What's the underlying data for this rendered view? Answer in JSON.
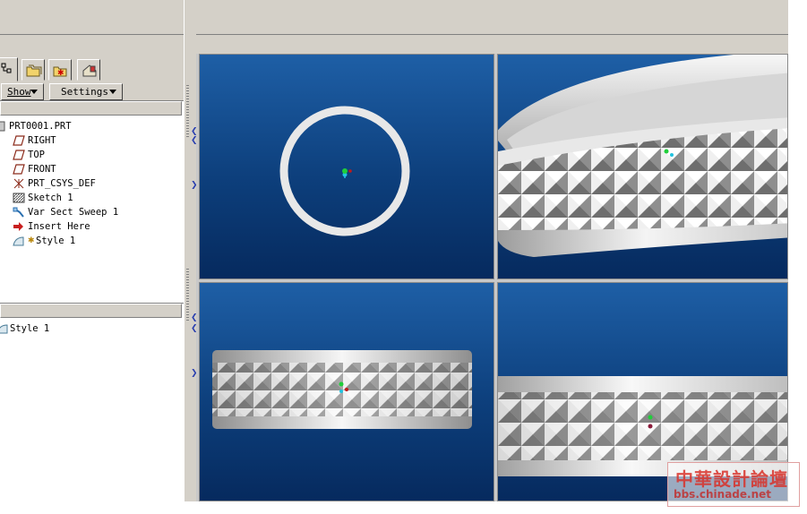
{
  "nav": {
    "tabs": [
      {
        "icon": "model-tree-icon"
      },
      {
        "icon": "folder-browser-icon"
      },
      {
        "icon": "favorites-icon"
      },
      {
        "icon": "connections-icon"
      }
    ],
    "show_label": "Show",
    "settings_label": "Settings"
  },
  "model_tree": {
    "items": [
      {
        "label": "PRT0001.PRT",
        "icon": "part-icon"
      },
      {
        "label": "RIGHT",
        "icon": "datum-plane-icon"
      },
      {
        "label": "TOP",
        "icon": "datum-plane-icon"
      },
      {
        "label": "FRONT",
        "icon": "datum-plane-icon"
      },
      {
        "label": "PRT_CSYS_DEF",
        "icon": "csys-icon"
      },
      {
        "label": "Sketch 1",
        "icon": "sketch-icon"
      },
      {
        "label": "Var Sect Sweep 1",
        "icon": "sweep-icon"
      },
      {
        "label": "Insert Here",
        "icon": "insert-arrow-icon"
      },
      {
        "label": "Style 1",
        "icon": "style-icon"
      }
    ]
  },
  "layers": {
    "items": [
      {
        "label": "Style 1",
        "icon": "style-icon"
      }
    ]
  },
  "viewports": [
    {
      "name": "front-view"
    },
    {
      "name": "isometric-view"
    },
    {
      "name": "side-view"
    },
    {
      "name": "perspective-view"
    }
  ],
  "watermark": {
    "line1": "中華設計論壇",
    "line2": "bbs.chinade.net"
  },
  "colors": {
    "viewport_top": "#1e5fa6",
    "viewport_bottom": "#062a5e",
    "ring": "#e8e8e8"
  }
}
